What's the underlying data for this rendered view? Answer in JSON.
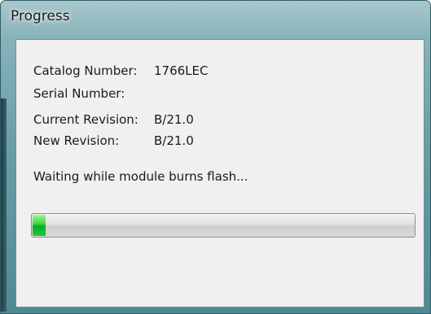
{
  "window": {
    "title": "Progress"
  },
  "info": {
    "catalog_label": "Catalog Number:",
    "catalog_value": "1766LEC",
    "serial_label": "Serial Number:",
    "serial_value": "",
    "current_rev_label": "Current Revision:",
    "current_rev_value": "B/21.0",
    "new_rev_label": "New Revision:",
    "new_rev_value": "B/21.0"
  },
  "status": {
    "message": "Waiting while module burns flash..."
  },
  "progress": {
    "fraction": 0.035
  },
  "colors": {
    "progress_fill": "#06b025",
    "titlebar": "#88b3ba"
  }
}
